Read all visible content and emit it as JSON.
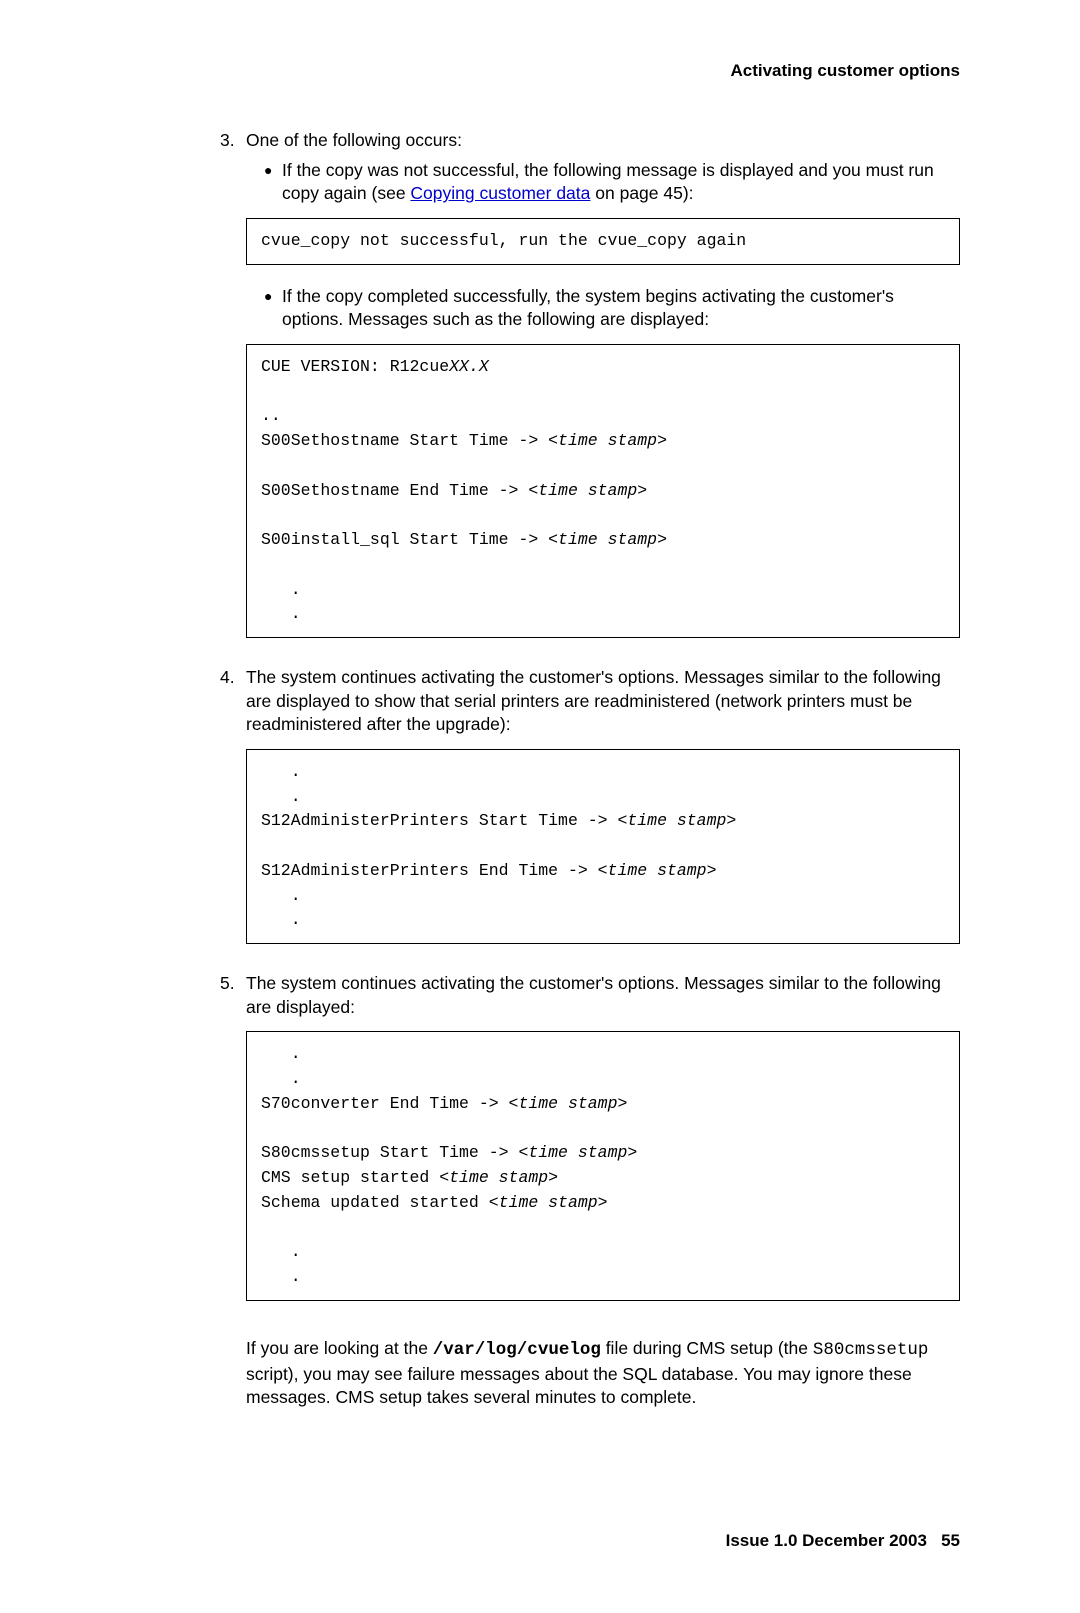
{
  "header": "Activating customer options",
  "step3": {
    "num": "3.",
    "intro": "One of the following occurs:",
    "bullet1a": "If the copy was not successful, the following message is displayed and you must run copy again (see ",
    "bullet1_link": "Copying customer data",
    "bullet1b": " on page 45):",
    "code1": "cvue_copy not successful, run the cvue_copy again",
    "bullet2": "If the copy completed successfully, the system begins activating the customer's options. Messages such as the following are displayed:",
    "code2_l1": "CUE VERSION: R12cue",
    "code2_l1i": "XX.X",
    "code2_l2": "..",
    "code2_l3a": "S00Sethostname Start Time -> ",
    "code2_l3i": "<time stamp>",
    "code2_l4a": "S00Sethostname End Time -> ",
    "code2_l4i": "<time stamp>",
    "code2_l5a": "S00install_sql Start Time -> ",
    "code2_l5i": "<time stamp>",
    "code2_l6": "   .",
    "code2_l7": "   ."
  },
  "step4": {
    "num": "4.",
    "intro": "The system continues activating the customer's options. Messages similar to the following are displayed to show that serial printers are readministered (network printers must be readministered after the upgrade):",
    "code_l1": "   .",
    "code_l2": "   .",
    "code_l3a": "S12AdministerPrinters Start Time -> ",
    "code_l3i": "<time stamp>",
    "code_l4a": "S12AdministerPrinters End Time -> ",
    "code_l4i": "<time stamp>",
    "code_l5": "   .",
    "code_l6": "   ."
  },
  "step5": {
    "num": "5.",
    "intro": "The system continues activating the customer's options. Messages similar to the following are displayed:",
    "code_l1": "   .",
    "code_l2": "   .",
    "code_l3a": "S70converter End Time -> ",
    "code_l3i": "<time stamp>",
    "code_l4a": "S80cmssetup Start Time -> ",
    "code_l4i": "<time stamp>",
    "code_l5a": "CMS setup started ",
    "code_l5i": "<time stamp>",
    "code_l6a": "Schema updated started ",
    "code_l6i": "<time stamp>",
    "code_l7": "   .",
    "code_l8": "   .",
    "note_a": "If you are looking at the ",
    "note_path": "/var/log/cvuelog",
    "note_b": " file during CMS setup (the ",
    "note_script": "S80cmssetup",
    "note_c": " script), you may see failure messages about the SQL database. You may ignore these messages. CMS setup takes several minutes to complete."
  },
  "footer": {
    "issue": "Issue 1.0   December 2003",
    "page": "55"
  }
}
